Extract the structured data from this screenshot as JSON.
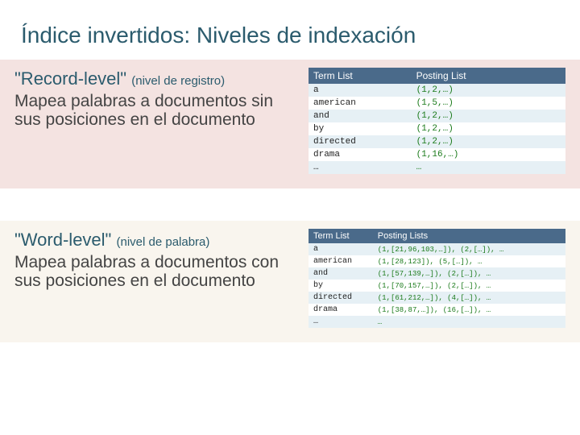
{
  "title": "Índice invertidos: Niveles de indexación",
  "record": {
    "heading_main": "\"Record-level\"",
    "heading_sub": "(nivel de registro)",
    "desc": "Mapea palabras a documentos sin sus posiciones en el documento",
    "th1": "Term List",
    "th2": "Posting List",
    "rows": [
      {
        "term": "a",
        "post": "(1,2,…)"
      },
      {
        "term": "american",
        "post": "(1,5,…)"
      },
      {
        "term": "and",
        "post": "(1,2,…)"
      },
      {
        "term": "by",
        "post": "(1,2,…)"
      },
      {
        "term": "directed",
        "post": "(1,2,…)"
      },
      {
        "term": "drama",
        "post": "(1,16,…)"
      },
      {
        "term": "…",
        "post": "…"
      }
    ]
  },
  "word": {
    "heading_main": "\"Word-level\"",
    "heading_sub": "(nivel de palabra)",
    "desc": "Mapea palabras a documentos con sus posiciones en el documento",
    "th1": "Term List",
    "th2": "Posting Lists",
    "rows": [
      {
        "term": "a",
        "post": "(1,[21,96,103,…]), (2,[…]), …"
      },
      {
        "term": "american",
        "post": "(1,[28,123]), (5,[…]), …"
      },
      {
        "term": "and",
        "post": "(1,[57,139,…]), (2,[…]), …"
      },
      {
        "term": "by",
        "post": "(1,[70,157,…]), (2,[…]), …"
      },
      {
        "term": "directed",
        "post": "(1,[61,212,…]), (4,[…]), …"
      },
      {
        "term": "drama",
        "post": "(1,[38,87,…]), (16,[…]), …"
      },
      {
        "term": "…",
        "post": "…"
      }
    ]
  }
}
